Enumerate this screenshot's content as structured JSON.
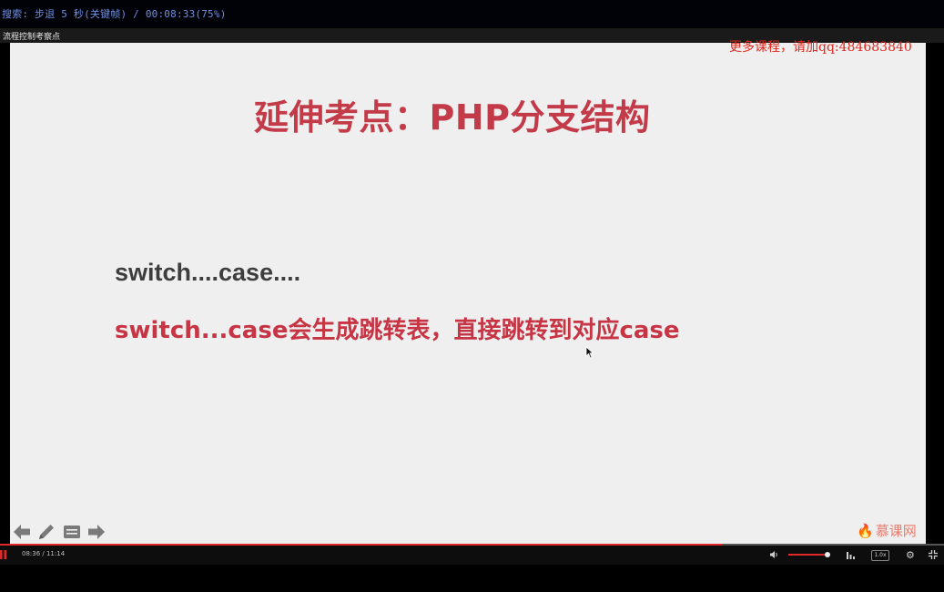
{
  "top_bar": {
    "search_status": "搜索: 步退 5 秒(关键帧) / 00:08:33(75%)"
  },
  "video": {
    "title": "流程控制考察点"
  },
  "overlay": {
    "ad_text": "更多课程，请加qq:484683840"
  },
  "slide": {
    "title": "延伸考点：PHP分支结构",
    "line1": "switch....case....",
    "line2": "switch...case会生成跳转表，直接跳转到对应case",
    "brand": "慕课网",
    "tools": [
      "back-arrow-icon",
      "pen-icon",
      "note-icon",
      "forward-arrow-icon"
    ]
  },
  "controls": {
    "time": "08:36 / 11:14",
    "progress_fraction": 0.765,
    "volume_fraction": 0.97,
    "speed_label": "1.0x",
    "accent_color": "#e02828"
  }
}
